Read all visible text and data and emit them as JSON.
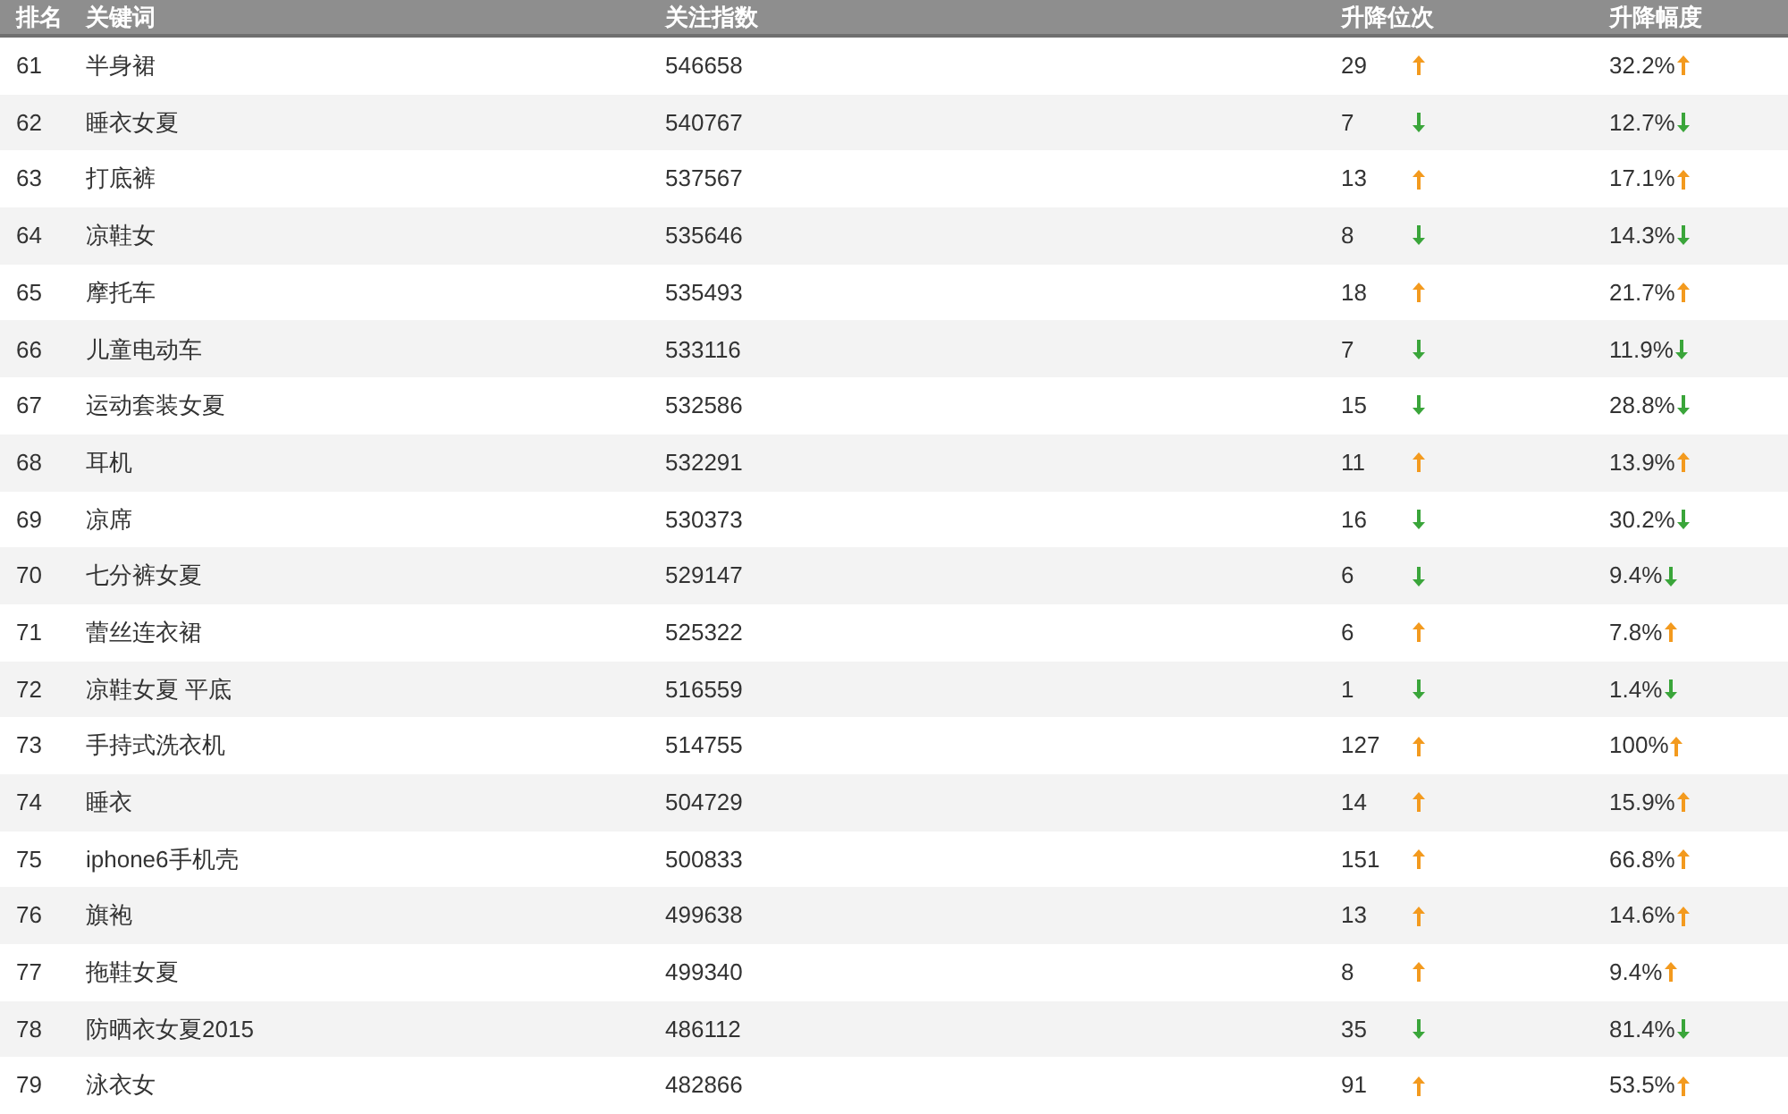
{
  "table": {
    "columns": [
      "排名",
      "关键词",
      "关注指数",
      "升降位次",
      "升降幅度"
    ],
    "rows": [
      {
        "rank": "61",
        "keyword": "半身裙",
        "index": "546658",
        "change": "29",
        "rising": true,
        "pct": "32.2%"
      },
      {
        "rank": "62",
        "keyword": "睡衣女夏",
        "index": "540767",
        "change": "7",
        "rising": false,
        "pct": "12.7%"
      },
      {
        "rank": "63",
        "keyword": "打底裤",
        "index": "537567",
        "change": "13",
        "rising": true,
        "pct": "17.1%"
      },
      {
        "rank": "64",
        "keyword": "凉鞋女",
        "index": "535646",
        "change": "8",
        "rising": false,
        "pct": "14.3%"
      },
      {
        "rank": "65",
        "keyword": "摩托车",
        "index": "535493",
        "change": "18",
        "rising": true,
        "pct": "21.7%"
      },
      {
        "rank": "66",
        "keyword": "儿童电动车",
        "index": "533116",
        "change": "7",
        "rising": false,
        "pct": "11.9%"
      },
      {
        "rank": "67",
        "keyword": "运动套装女夏",
        "index": "532586",
        "change": "15",
        "rising": false,
        "pct": "28.8%"
      },
      {
        "rank": "68",
        "keyword": "耳机",
        "index": "532291",
        "change": "11",
        "rising": true,
        "pct": "13.9%"
      },
      {
        "rank": "69",
        "keyword": "凉席",
        "index": "530373",
        "change": "16",
        "rising": false,
        "pct": "30.2%"
      },
      {
        "rank": "70",
        "keyword": "七分裤女夏",
        "index": "529147",
        "change": "6",
        "rising": false,
        "pct": "9.4%"
      },
      {
        "rank": "71",
        "keyword": "蕾丝连衣裙",
        "index": "525322",
        "change": "6",
        "rising": true,
        "pct": "7.8%"
      },
      {
        "rank": "72",
        "keyword": "凉鞋女夏 平底",
        "index": "516559",
        "change": "1",
        "rising": false,
        "pct": "1.4%"
      },
      {
        "rank": "73",
        "keyword": "手持式洗衣机",
        "index": "514755",
        "change": "127",
        "rising": true,
        "pct": "100%"
      },
      {
        "rank": "74",
        "keyword": "睡衣",
        "index": "504729",
        "change": "14",
        "rising": true,
        "pct": "15.9%"
      },
      {
        "rank": "75",
        "keyword": "iphone6手机壳",
        "index": "500833",
        "change": "151",
        "rising": true,
        "pct": "66.8%"
      },
      {
        "rank": "76",
        "keyword": "旗袍",
        "index": "499638",
        "change": "13",
        "rising": true,
        "pct": "14.6%"
      },
      {
        "rank": "77",
        "keyword": "拖鞋女夏",
        "index": "499340",
        "change": "8",
        "rising": true,
        "pct": "9.4%"
      },
      {
        "rank": "78",
        "keyword": "防晒衣女夏2015",
        "index": "486112",
        "change": "35",
        "rising": false,
        "pct": "81.4%"
      },
      {
        "rank": "79",
        "keyword": "泳衣女",
        "index": "482866",
        "change": "91",
        "rising": true,
        "pct": "53.5%"
      }
    ]
  }
}
